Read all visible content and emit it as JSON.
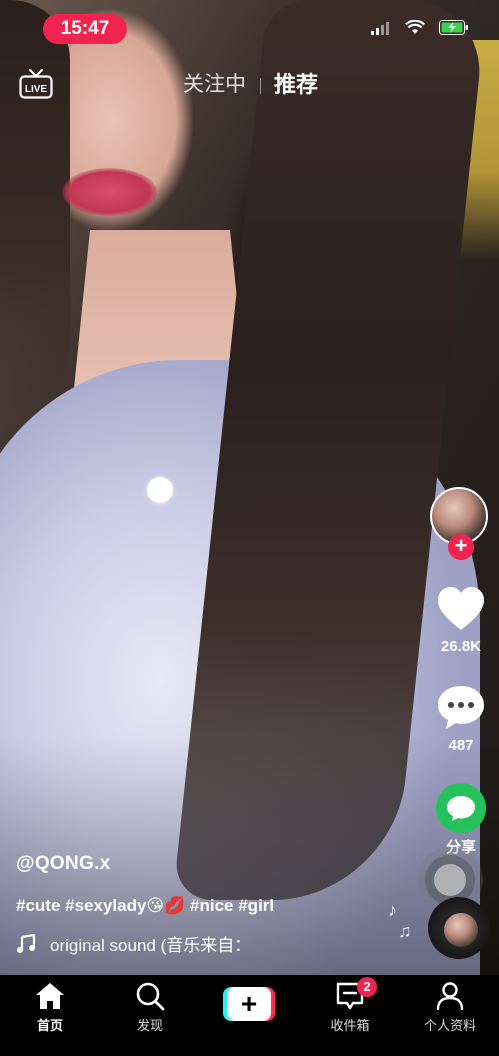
{
  "status_bar": {
    "time": "15:47"
  },
  "top_nav": {
    "live_label": "LIVE",
    "tabs": [
      {
        "label": "关注中",
        "active": false
      },
      {
        "label": "推荐",
        "active": true
      }
    ]
  },
  "actions": {
    "likes": "26.8K",
    "comments": "487",
    "share_label": "分享"
  },
  "caption": {
    "username": "@QONG.x",
    "hashtags": "#cute #sexylady😘💋 #nice #girl",
    "music": "original sound (音乐来自："
  },
  "bottom_nav": {
    "items": [
      {
        "label": "首页",
        "icon": "home-icon",
        "active": true
      },
      {
        "label": "发现",
        "icon": "search-icon",
        "active": false
      },
      {
        "label": "",
        "icon": "create-plus-icon",
        "active": false
      },
      {
        "label": "收件箱",
        "icon": "inbox-icon",
        "active": false
      },
      {
        "label": "个人资料",
        "icon": "profile-icon",
        "active": false
      }
    ],
    "inbox_badge": "2"
  },
  "colors": {
    "accent_red": "#f2244f",
    "share_green": "#25c15b",
    "tiktok_cyan": "#25f4ee",
    "tiktok_pink": "#fe2c55"
  }
}
